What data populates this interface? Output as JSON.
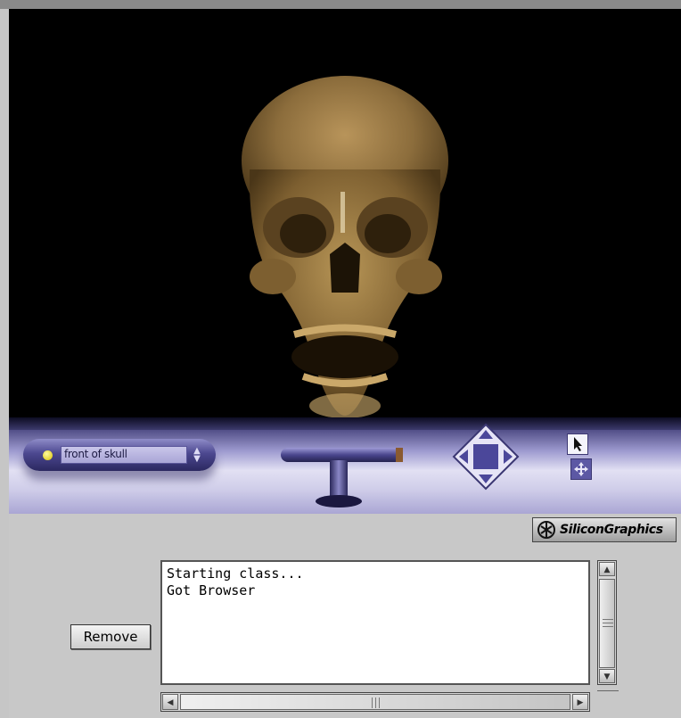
{
  "viewer": {
    "viewpoint_label": "front of skull",
    "tools": [
      "viewpoint-selector",
      "walk-tool",
      "pan-tool",
      "pointer-tool",
      "move-tool"
    ]
  },
  "brand": {
    "label": "SiliconGraphics"
  },
  "actions": {
    "remove_label": "Remove"
  },
  "console": {
    "lines": [
      "Starting class...",
      "Got Browser"
    ]
  },
  "colors": {
    "viewport_bg": "#000000",
    "dashboard_accent": "#4e4b84",
    "skull_tone": "#9a7a44"
  }
}
